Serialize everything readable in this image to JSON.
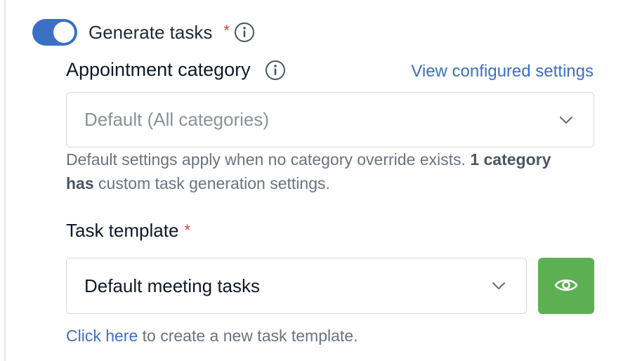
{
  "generate_tasks": {
    "label": "Generate tasks",
    "required_marker": "*",
    "enabled": true,
    "toggle_color": "#3b70c4"
  },
  "appointment_category": {
    "label": "Appointment category",
    "view_link": "View configured settings",
    "select_value": "Default (All categories)",
    "help_prefix": "Default settings apply when no category override exists.",
    "help_bold": "1 category has",
    "help_suffix": "custom task generation settings."
  },
  "task_template": {
    "label": "Task template",
    "required_marker": "*",
    "select_value": "Default meeting tasks",
    "preview_button_color": "#5cb052"
  },
  "footer": {
    "link_text": "Click here",
    "text": "to create a new task template."
  },
  "colors": {
    "link": "#3b70c4",
    "required": "#d14343"
  }
}
